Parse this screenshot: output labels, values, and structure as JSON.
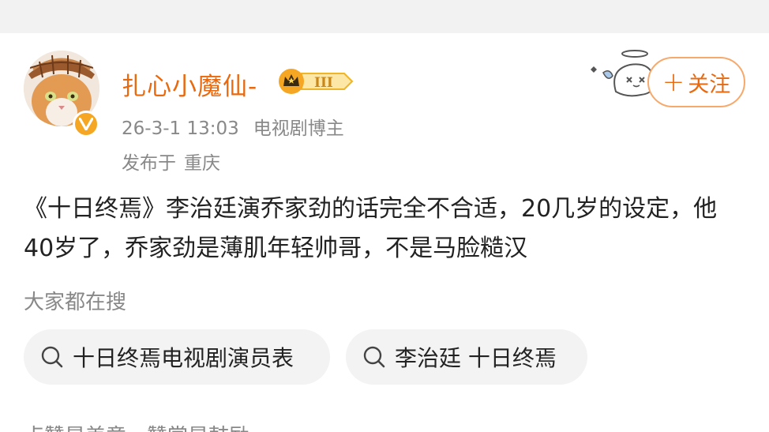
{
  "post": {
    "author": {
      "username": "扎心小魔仙-",
      "verified": true,
      "rank_badge": "III"
    },
    "time": "26-3-1 13:03",
    "author_tag": "电视剧博主",
    "location_prefix": "发布于",
    "location": "重庆",
    "follow_label": "关注",
    "text": "《十日终焉》李治廷演乔家劲的话完全不合适，20几岁的设定，他40岁了，乔家劲是薄肌年轻帅哥，不是马脸糙汉"
  },
  "search": {
    "label": "大家都在搜",
    "chips": [
      {
        "text": "十日终焉电视剧演员表",
        "icon": "search-icon"
      },
      {
        "text": "李治廷 十日终焉",
        "icon": "search-icon"
      }
    ]
  },
  "next_item_partial": "点赞是美意，赞赏是鼓励",
  "colors": {
    "username": "#e86a10",
    "follow_border": "#f7a86b",
    "meta_gray": "#888888",
    "chip_bg": "#f3f3f3",
    "vip_gold": "#f5a623"
  }
}
